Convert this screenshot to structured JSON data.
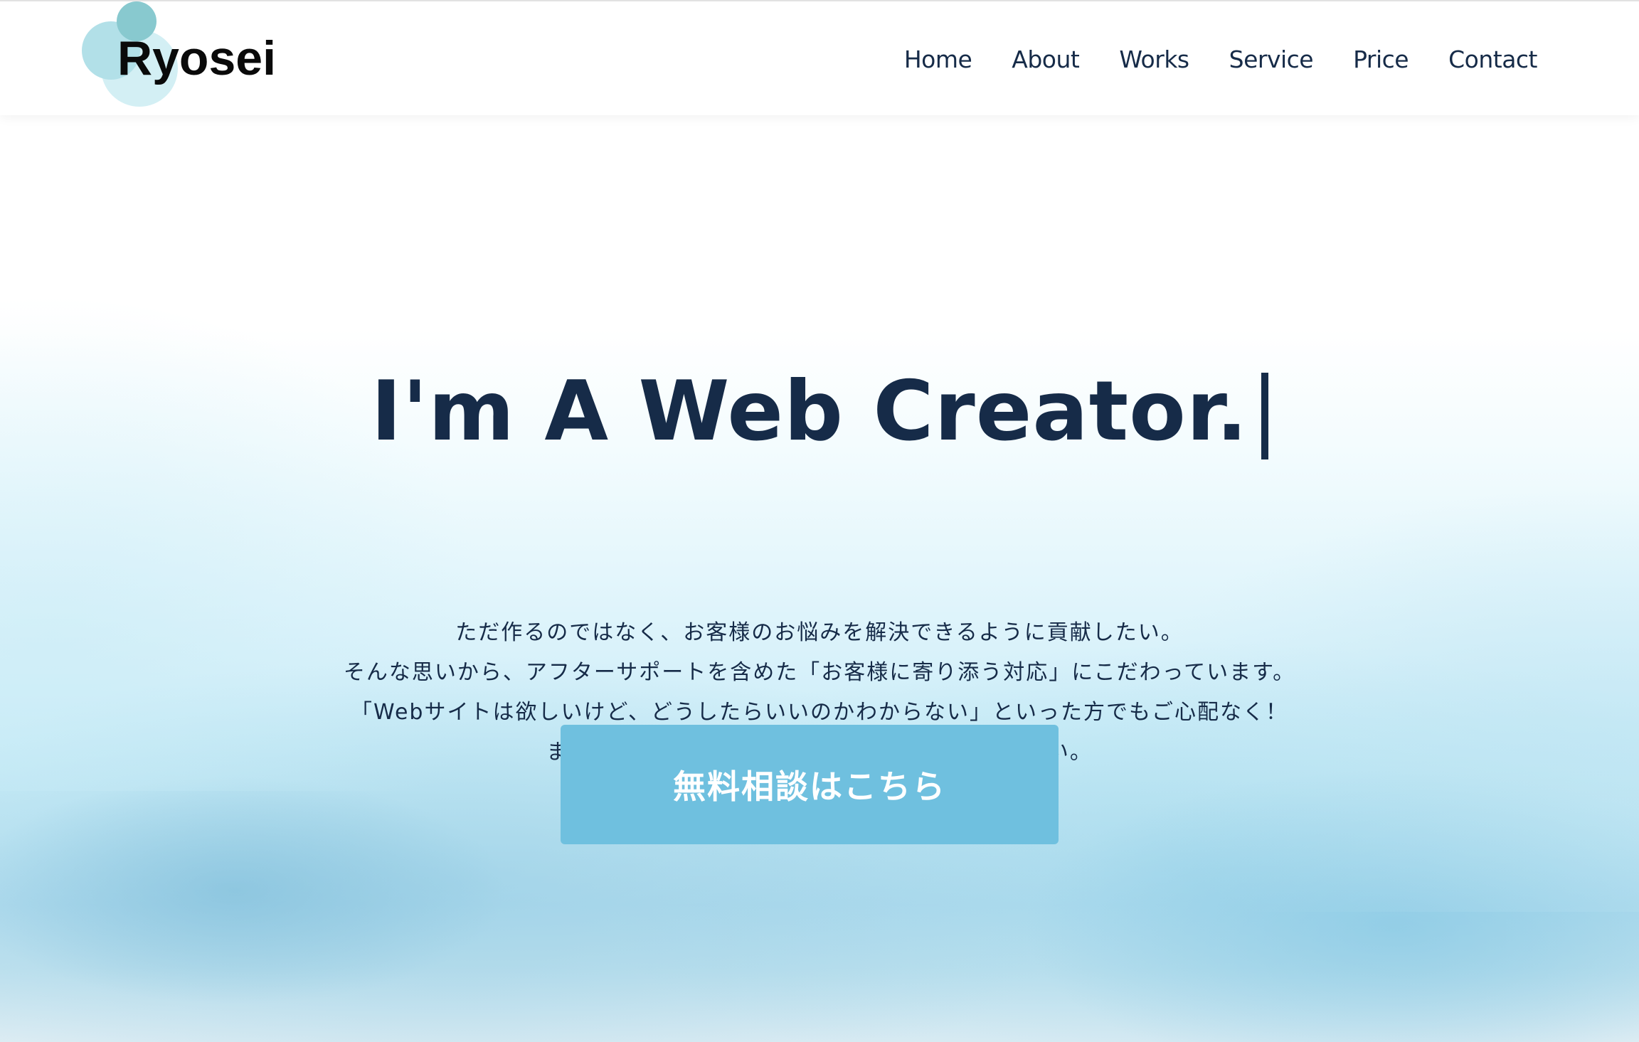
{
  "header": {
    "logo_text": "Ryosei",
    "nav": [
      {
        "label": "Home"
      },
      {
        "label": "About"
      },
      {
        "label": "Works"
      },
      {
        "label": "Service"
      },
      {
        "label": "Price"
      },
      {
        "label": "Contact"
      }
    ]
  },
  "hero": {
    "title": "I'm A Web Creator.",
    "description_lines": [
      "ただ作るのではなく、お客様のお悩みを解決できるように貢献したい。",
      "そんな思いから、アフターサポートを含めた「お客様に寄り添う対応」にこだわっています。",
      "「Webサイトは欲しいけど、どうしたらいいのかわからない」といった方でもご心配なく！",
      "まずは無料相談であなたのお悩みをお聞かせ下さい。"
    ],
    "cta_label": "無料相談はこちら"
  },
  "colors": {
    "text_primary": "#162b48",
    "cta_background": "#6fc0df",
    "logo_circle_dark": "#88c9cf",
    "logo_circle_mid": "#b2e0e8",
    "logo_circle_light": "#d3eff4"
  }
}
